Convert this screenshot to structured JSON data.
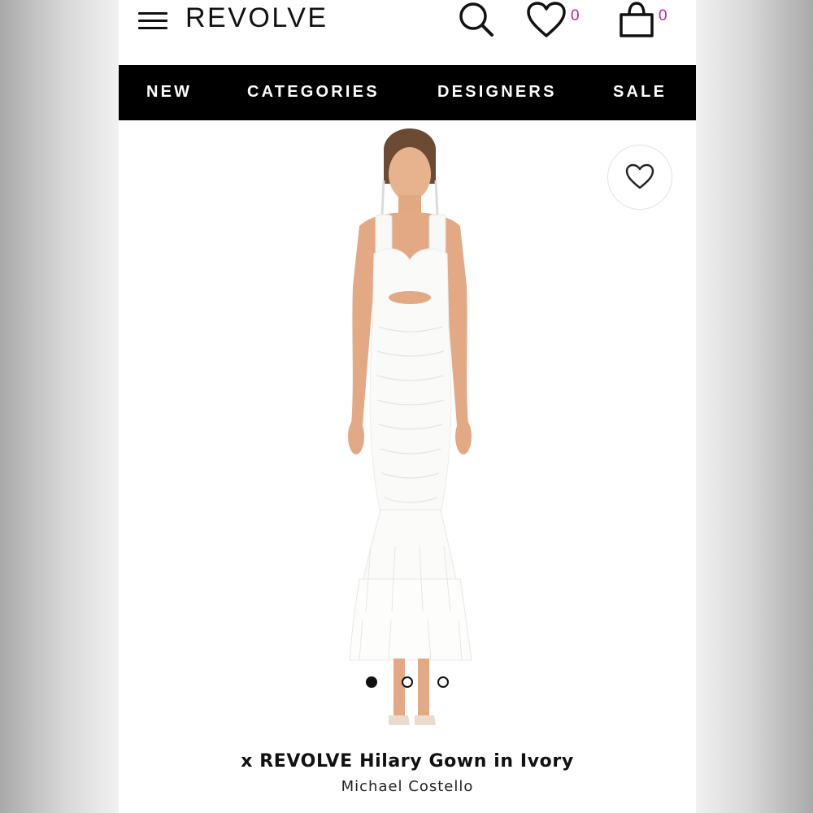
{
  "header": {
    "logo": "REVOLVE",
    "wishlist_count": "0",
    "bag_count": "0",
    "accent_color": "#c0268d"
  },
  "nav": {
    "items": [
      {
        "label": "NEW"
      },
      {
        "label": "CATEGORIES"
      },
      {
        "label": "DESIGNERS"
      },
      {
        "label": "SALE"
      }
    ]
  },
  "icons": {
    "menu": "hamburger-menu-icon",
    "search": "search-icon",
    "wishlist": "heart-icon",
    "bag": "shopping-bag-icon",
    "favorite": "heart-outline-icon"
  },
  "carousel": {
    "total": 3,
    "active": 1
  },
  "product": {
    "title": "x REVOLVE Hilary Gown in Ivory",
    "designer": "Michael Costello"
  }
}
